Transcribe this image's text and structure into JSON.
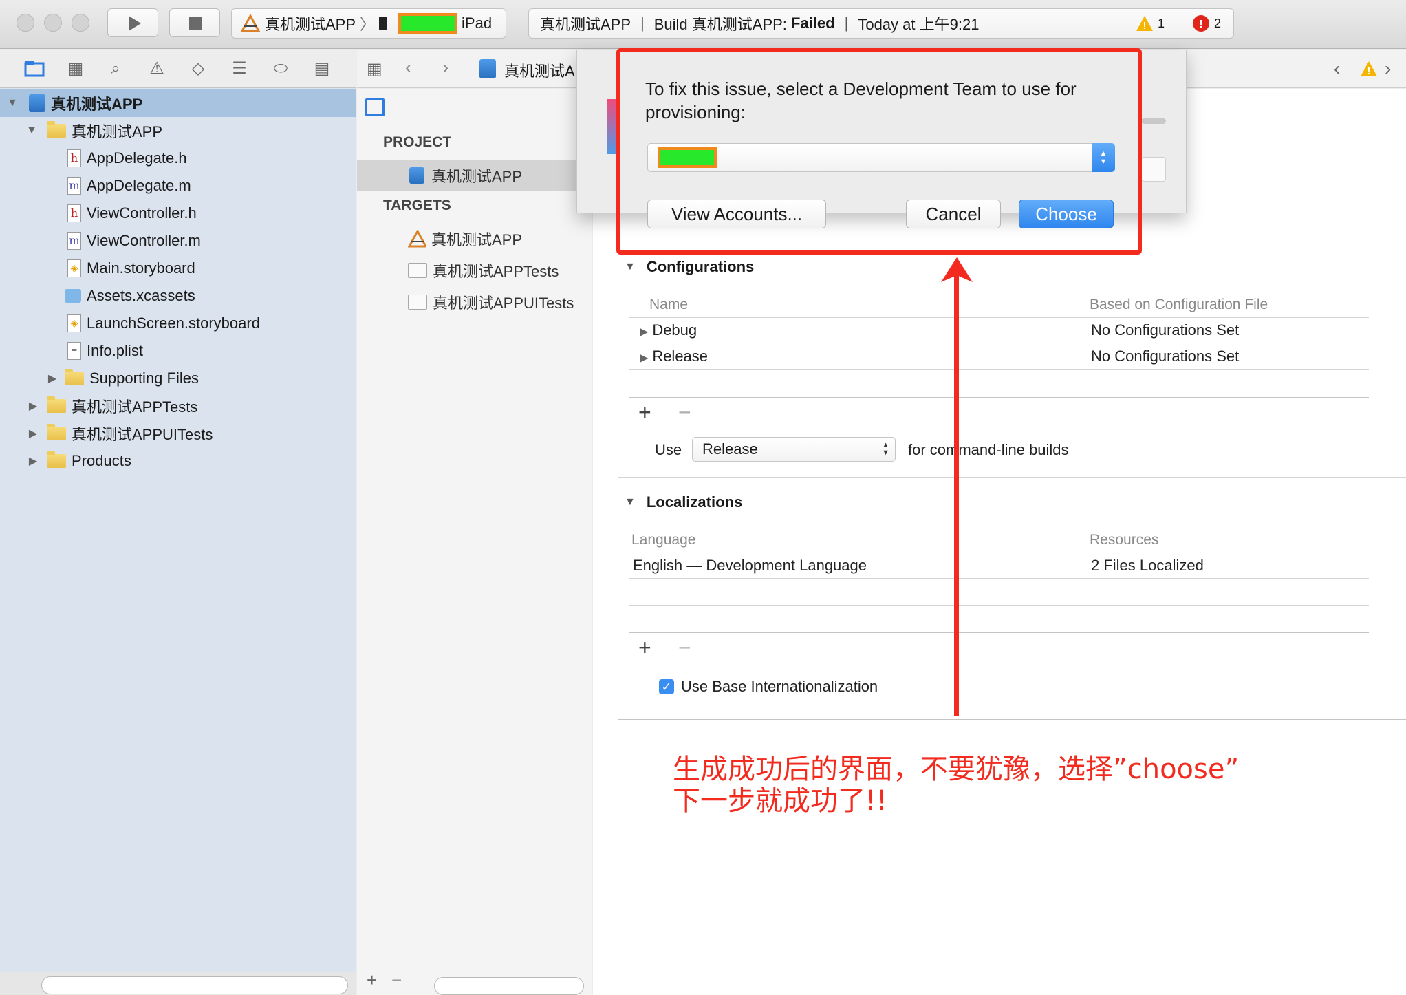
{
  "toolbar": {
    "scheme_name": "真机测试APP",
    "device_name": "iPad",
    "status": {
      "app": "真机测试APP",
      "build_prefix": "Build 真机测试APP: ",
      "build_result": "Failed",
      "time": "Today at 上午9:21"
    },
    "warnings_count": "1",
    "errors_count": "2",
    "warning_color": "#f5b400",
    "error_color": "#e0261a"
  },
  "navigator": {
    "items": [
      {
        "label": "真机测试APP",
        "kind": "project"
      },
      {
        "label": "真机测试APP",
        "kind": "folder"
      },
      {
        "label": "AppDelegate.h",
        "kind": "h"
      },
      {
        "label": "AppDelegate.m",
        "kind": "m"
      },
      {
        "label": "ViewController.h",
        "kind": "h"
      },
      {
        "label": "ViewController.m",
        "kind": "m"
      },
      {
        "label": "Main.storyboard",
        "kind": "storyboard"
      },
      {
        "label": "Assets.xcassets",
        "kind": "assets"
      },
      {
        "label": "LaunchScreen.storyboard",
        "kind": "storyboard"
      },
      {
        "label": "Info.plist",
        "kind": "plist"
      },
      {
        "label": "Supporting Files",
        "kind": "folder"
      },
      {
        "label": "真机测试APPTests",
        "kind": "folder"
      },
      {
        "label": "真机测试APPUITests",
        "kind": "folder"
      },
      {
        "label": "Products",
        "kind": "folder"
      }
    ]
  },
  "editor": {
    "breadcrumb": "真机测试A"
  },
  "targets_list": {
    "project_header": "PROJECT",
    "project_item": "真机测试APP",
    "targets_header": "TARGETS",
    "targets": [
      "真机测试APP",
      "真机测试APPTests",
      "真机测试APPUITests"
    ]
  },
  "settings": {
    "configurations": {
      "title": "Configurations",
      "col_name": "Name",
      "col_based": "Based on Configuration File",
      "rows": [
        {
          "name": "Debug",
          "based": "No Configurations Set"
        },
        {
          "name": "Release",
          "based": "No Configurations Set"
        }
      ],
      "use_label": "Use",
      "use_value": "Release",
      "use_suffix": "for command-line builds"
    },
    "localizations": {
      "title": "Localizations",
      "col_language": "Language",
      "col_resources": "Resources",
      "rows": [
        {
          "language": "English — Development Language",
          "resources": "2 Files Localized"
        }
      ],
      "base_intl_label": "Use Base Internationalization",
      "base_intl_checked": true
    }
  },
  "dialog": {
    "message": "To fix this issue, select a Development Team to use for provisioning:",
    "view_accounts": "View Accounts...",
    "cancel": "Cancel",
    "choose": "Choose",
    "highlight_color": "#f22b1e"
  },
  "annotation": {
    "line1": "生成成功后的界面，不要犹豫，选择”choose”",
    "line2": "下一步就成功了!!"
  }
}
